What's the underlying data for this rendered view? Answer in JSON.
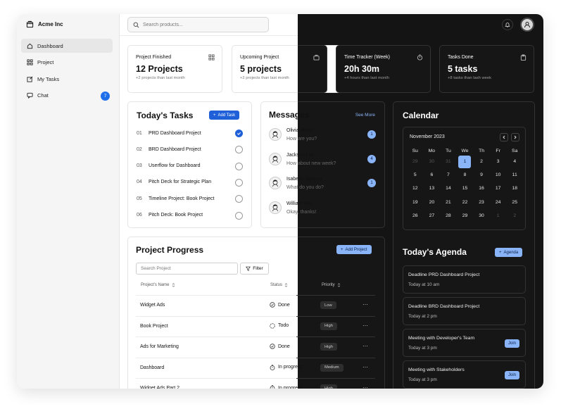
{
  "sidebar": {
    "brand": "Acme Inc",
    "items": [
      {
        "label": "Dashboard",
        "icon": "home-icon"
      },
      {
        "label": "Project",
        "icon": "grid-icon"
      },
      {
        "label": "My Tasks",
        "icon": "edit-icon"
      },
      {
        "label": "Chat",
        "icon": "chat-icon",
        "badge": "7"
      }
    ]
  },
  "topbar": {
    "search_placeholder": "Search products..."
  },
  "stats": [
    {
      "label": "Project Finished",
      "value": "12 Projects",
      "sub": "+2 projects than last month"
    },
    {
      "label": "Upcoming Project",
      "value": "5 projects",
      "sub": "+2 projects than last month"
    },
    {
      "label": "Time Tracker (Week)",
      "value": "20h 30m",
      "sub": "+4 hours than last month"
    },
    {
      "label": "Tasks Done",
      "value": "5 tasks",
      "sub": "+8 tasks than lash week"
    }
  ],
  "tasks": {
    "title": "Today's Tasks",
    "add_label": "Add Task",
    "items": [
      {
        "num": "01",
        "label": "PRD Dashboard Project",
        "done": true
      },
      {
        "num": "02",
        "label": "BRD Dashboard Project",
        "done": false
      },
      {
        "num": "03",
        "label": "Userflow for Dashboard",
        "done": false
      },
      {
        "num": "04",
        "label": "Pitch Deck for Strategic Plan",
        "done": false
      },
      {
        "num": "05",
        "label": "Timeline Project: Book Project",
        "done": false
      },
      {
        "num": "06",
        "label": "Pitch Deck: Book Project",
        "done": false
      }
    ]
  },
  "messages": {
    "title": "Messages",
    "see_more": "See More",
    "items": [
      {
        "name": "Olivia Martin",
        "text": "How are you?",
        "badge": "1"
      },
      {
        "name": "Jackson Lee",
        "text": "How about new week?",
        "badge": "4"
      },
      {
        "name": "Isabella Nguyen",
        "text": "What do you do?",
        "badge": "1"
      },
      {
        "name": "William Kim",
        "text": "Okay, thanks!",
        "badge": ""
      }
    ]
  },
  "progress": {
    "title": "Project Progress",
    "add_label": "Add Project",
    "search_placeholder": "Search Project",
    "filter_label": "Filter",
    "columns": [
      "Project's Name",
      "Status",
      "Priority"
    ],
    "rows": [
      {
        "name": "Widget Ads",
        "status": "Done",
        "status_icon": "check-circle-icon",
        "priority": "Low"
      },
      {
        "name": "Book Project",
        "status": "Todo",
        "status_icon": "circle-icon",
        "priority": "High"
      },
      {
        "name": "Ads for Marketing",
        "status": "Done",
        "status_icon": "check-circle-icon",
        "priority": "High"
      },
      {
        "name": "Dashboard",
        "status": "In progress",
        "status_icon": "timer-icon",
        "priority": "Medium"
      },
      {
        "name": "Widget Ads Part 2",
        "status": "In progress",
        "status_icon": "timer-icon",
        "priority": "High"
      }
    ],
    "more_label": "···"
  },
  "calendar": {
    "title": "Calendar",
    "month": "November 2023",
    "weekdays": [
      "Su",
      "Mo",
      "Tu",
      "We",
      "Th",
      "Fr",
      "Sa"
    ],
    "days": [
      {
        "d": "29",
        "muted": true
      },
      {
        "d": "30",
        "muted": true
      },
      {
        "d": "31",
        "muted": true
      },
      {
        "d": "1",
        "today": true
      },
      {
        "d": "2"
      },
      {
        "d": "3"
      },
      {
        "d": "4"
      },
      {
        "d": "5"
      },
      {
        "d": "6"
      },
      {
        "d": "7"
      },
      {
        "d": "8"
      },
      {
        "d": "9"
      },
      {
        "d": "10"
      },
      {
        "d": "11"
      },
      {
        "d": "12"
      },
      {
        "d": "13"
      },
      {
        "d": "14"
      },
      {
        "d": "15"
      },
      {
        "d": "16"
      },
      {
        "d": "17"
      },
      {
        "d": "18"
      },
      {
        "d": "19"
      },
      {
        "d": "20"
      },
      {
        "d": "21"
      },
      {
        "d": "22"
      },
      {
        "d": "23"
      },
      {
        "d": "24"
      },
      {
        "d": "25"
      },
      {
        "d": "26"
      },
      {
        "d": "27"
      },
      {
        "d": "28"
      },
      {
        "d": "29"
      },
      {
        "d": "30"
      },
      {
        "d": "1",
        "muted": true
      },
      {
        "d": "2",
        "muted": true
      }
    ]
  },
  "agenda": {
    "title": "Today's Agenda",
    "add_label": "Agenda",
    "items": [
      {
        "title": "Deadline PRD Dashboard Project",
        "time": "Today at 10 am",
        "join": ""
      },
      {
        "title": "Deadline BRD Dashboard Project",
        "time": "Today at 2 pm",
        "join": ""
      },
      {
        "title": "Meeting with Developer's Team",
        "time": "Today at 3 pm",
        "join": "Join"
      },
      {
        "title": "Meeting with Stakeholders",
        "time": "Today at 3 pm",
        "join": "Join"
      }
    ]
  },
  "colors": {
    "accent": "#1f5fd8",
    "accent_dark_mode": "#8ab4f8",
    "dark_bg": "#141414"
  }
}
